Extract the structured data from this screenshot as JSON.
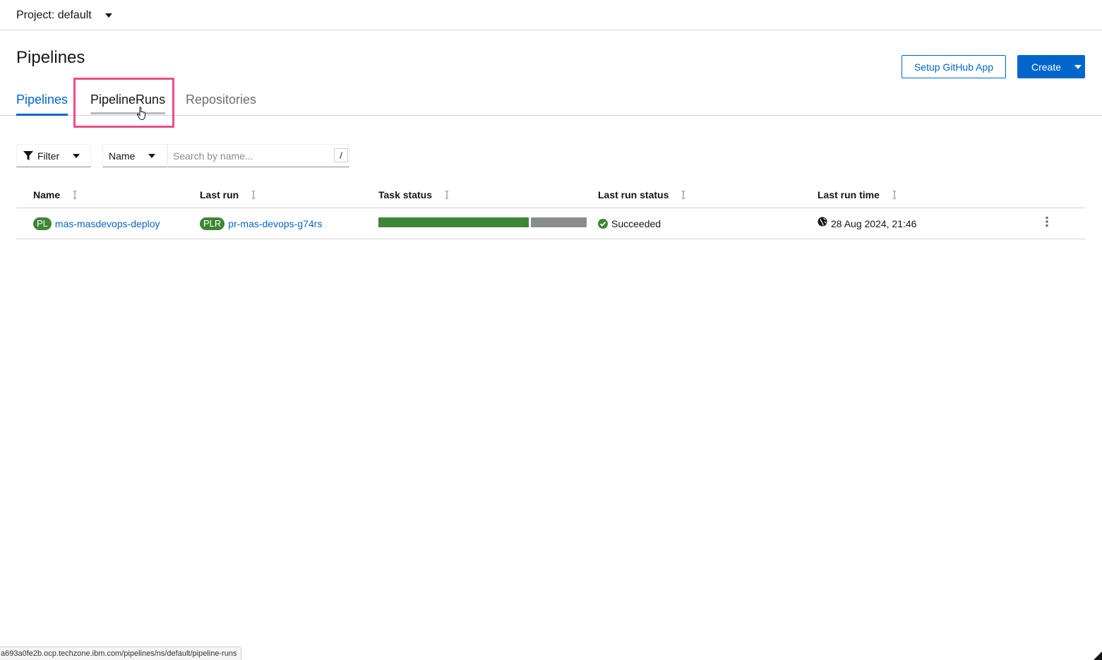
{
  "project_bar": {
    "label": "Project: default"
  },
  "page": {
    "title": "Pipelines"
  },
  "actions": {
    "setup_github": "Setup GitHub App",
    "create": "Create"
  },
  "tabs": [
    {
      "label": "Pipelines",
      "state": "active"
    },
    {
      "label": "PipelineRuns",
      "state": "hovered"
    },
    {
      "label": "Repositories",
      "state": "default"
    }
  ],
  "toolbar": {
    "filter_label": "Filter",
    "attribute_label": "Name",
    "search_placeholder": "Search by name...",
    "shortcut_hint": "/"
  },
  "table": {
    "columns": [
      "Name",
      "Last run",
      "Task status",
      "Last run status",
      "Last run time"
    ],
    "rows": [
      {
        "name_badge": "PL",
        "name": "mas-masdevops-deploy",
        "last_run_badge": "PLR",
        "last_run": "pr-mas-devops-g74rs",
        "task_status": {
          "succeeded_fraction": 0.73,
          "other_fraction": 0.27
        },
        "last_run_status": "Succeeded",
        "last_run_time": "28 Aug 2024, 21:46"
      }
    ]
  },
  "status_bar": {
    "url": "a693a0fe2b.ocp.techzone.ibm.com/pipelines/ns/default/pipeline-runs"
  },
  "colors": {
    "accent": "#0066cc",
    "success": "#3e8635",
    "neutral": "#8a8d90",
    "highlight": "#ea4d8c"
  },
  "icons": [
    "caret-down-icon",
    "funnel-icon",
    "sort-icon",
    "check-circle-icon",
    "globe-icon",
    "kebab-icon",
    "pointer-cursor-icon"
  ]
}
